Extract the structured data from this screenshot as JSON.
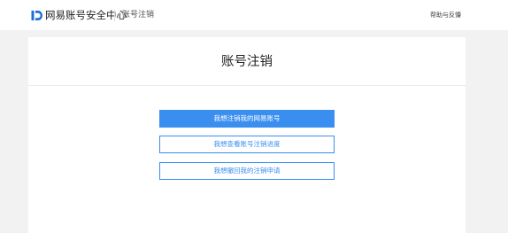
{
  "header": {
    "brand": "网易账号安全中心",
    "breadcrumb": "账号注销",
    "help_menu": "帮助与反馈"
  },
  "card": {
    "title": "账号注销",
    "buttons": [
      {
        "label": "我想注销我的网易账号"
      },
      {
        "label": "我想查看账号注销进度"
      },
      {
        "label": "我想撤回我的注销申请"
      }
    ]
  },
  "colors": {
    "accent": "#3a8ef0",
    "logo": "#1f6fd6",
    "background": "#f2f2f2"
  },
  "icons": [
    "netease-logo-icon",
    "chevron-down-icon"
  ]
}
